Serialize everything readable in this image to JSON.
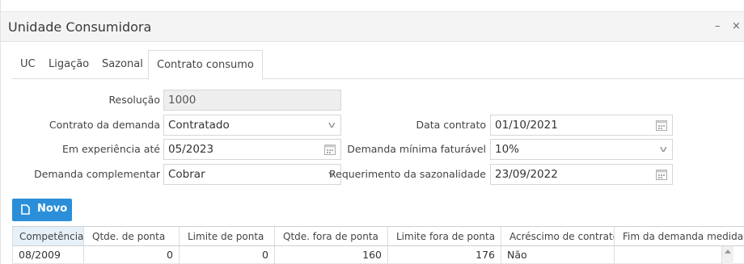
{
  "window": {
    "title": "Unidade Consumidora",
    "min_label": "–",
    "close_label": "×"
  },
  "tabs": [
    {
      "label": "UC"
    },
    {
      "label": "Ligação"
    },
    {
      "label": "Sazonal"
    },
    {
      "label": "Contrato consumo",
      "active": true
    }
  ],
  "form": {
    "resolucao": {
      "label": "Resolução",
      "value": "1000"
    },
    "contrato_demanda": {
      "label": "Contrato da demanda",
      "value": "Contratado"
    },
    "em_experiencia": {
      "label": "Em experiência até",
      "value": "05/2023"
    },
    "demanda_complementar": {
      "label": "Demanda complementar",
      "value": "Cobrar"
    },
    "data_contrato": {
      "label": "Data contrato",
      "value": "01/10/2021"
    },
    "demanda_minima": {
      "label": "Demanda mínima faturável",
      "value": "10%"
    },
    "requerimento_sazonalidade": {
      "label": "Requerimento da sazonalidade",
      "value": "23/09/2022"
    }
  },
  "toolbar": {
    "novo_label": "Novo"
  },
  "grid": {
    "columns": [
      "Competência",
      "Qtde. de ponta",
      "Limite de ponta",
      "Qtde. fora de ponta",
      "Limite fora de ponta",
      "Acréscimo de contrato",
      "Fim da demanda medida"
    ],
    "sort_indicator": "^",
    "rows": [
      [
        "08/2009",
        "0",
        "0",
        "160",
        "176",
        "Não",
        ""
      ]
    ]
  },
  "colors": {
    "accent": "#2a8fd8",
    "header_selected": "#e6f0f8",
    "readonly_bg": "#eeeeee"
  },
  "icons": [
    "calendar-icon",
    "chevron-down-icon",
    "document-icon",
    "close-icon",
    "minimize-icon"
  ]
}
